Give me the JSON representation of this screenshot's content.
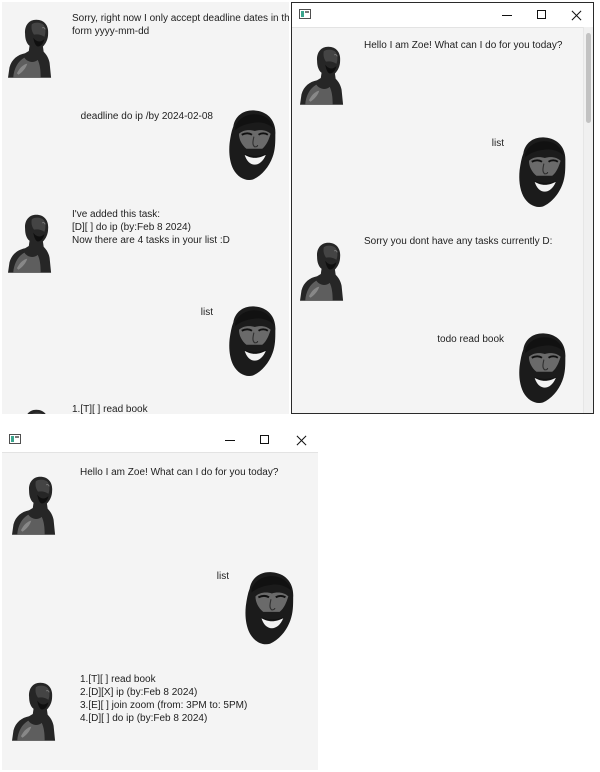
{
  "windows": [
    {
      "id": "win1",
      "messages": [
        {
          "from": "bot",
          "text": "Sorry, right now I only accept deadline dates in the\nform yyyy-mm-dd"
        },
        {
          "from": "user",
          "text": "deadline do ip /by 2024-02-08"
        },
        {
          "from": "bot",
          "text": "I've added this task:\n[D][ ] do ip (by:Feb 8 2024)\nNow there are 4 tasks in your list :D"
        },
        {
          "from": "user",
          "text": "list"
        },
        {
          "from": "bot",
          "text": "1.[T][ ] read book"
        }
      ]
    },
    {
      "id": "win2",
      "messages": [
        {
          "from": "bot",
          "text": "Hello I am Zoe! What can I do for you today?"
        },
        {
          "from": "user",
          "text": "list"
        },
        {
          "from": "bot",
          "text": "Sorry you dont have any tasks currently D:"
        },
        {
          "from": "user",
          "text": "todo read book"
        }
      ]
    },
    {
      "id": "win3",
      "messages": [
        {
          "from": "bot",
          "text": "Hello I am Zoe! What can I do for you today?"
        },
        {
          "from": "user",
          "text": "list"
        },
        {
          "from": "bot",
          "text": "1.[T][ ] read book\n2.[D][X] ip (by:Feb 8 2024)\n3.[E][ ] join zoom (from: 3PM to: 5PM)\n4.[D][ ] do ip (by:Feb 8 2024)"
        }
      ]
    }
  ],
  "icons": {
    "app": "app-window-icon",
    "minimize": "minimize-icon",
    "maximize": "maximize-icon",
    "close": "close-icon",
    "bot_avatar": "bot-avatar-icon",
    "user_avatar": "user-avatar-icon"
  },
  "colors": {
    "window_bg": "#f4f4f4",
    "titlebar_bg": "#ffffff",
    "text": "#1e1e1e",
    "avatar_dark": "#1b1b1b"
  }
}
